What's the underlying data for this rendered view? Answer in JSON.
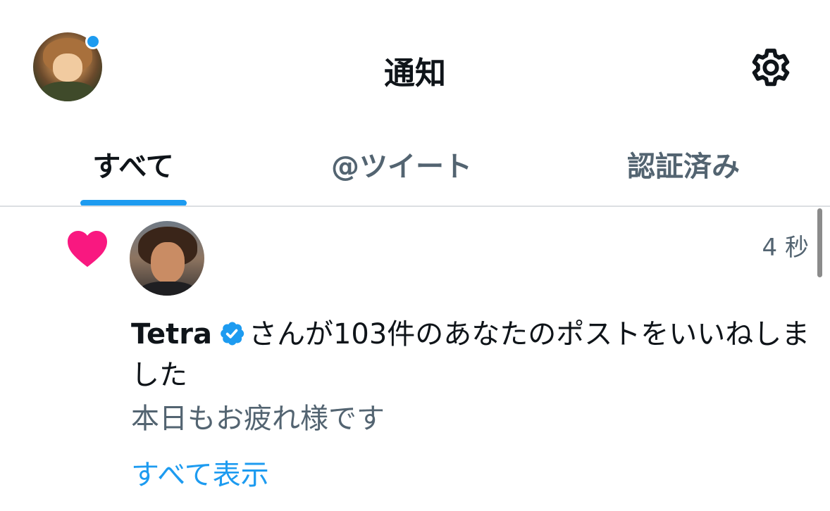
{
  "header": {
    "title": "通知",
    "avatar_icon": "user-avatar",
    "settings_icon": "gear-icon",
    "unread_indicator_color": "#1d9bf0"
  },
  "tabs": [
    {
      "label": "すべて",
      "selected": true
    },
    {
      "label": "@ツイート",
      "selected": false
    },
    {
      "label": "認証済み",
      "selected": false
    }
  ],
  "notification": {
    "type_icon": "heart-icon",
    "type_icon_color": "#f91880",
    "timestamp": "4 秒",
    "username": "Tetra",
    "verified_icon": "verified-badge-icon",
    "message": "さんが103件のあなたのポストをいいねしました",
    "quoted_text": "本日もお疲れ様です",
    "show_all_label": "すべて表示"
  },
  "colors": {
    "accent": "#1d9bf0",
    "text_primary": "#0f1419",
    "text_secondary": "#536471",
    "like": "#f91880"
  }
}
